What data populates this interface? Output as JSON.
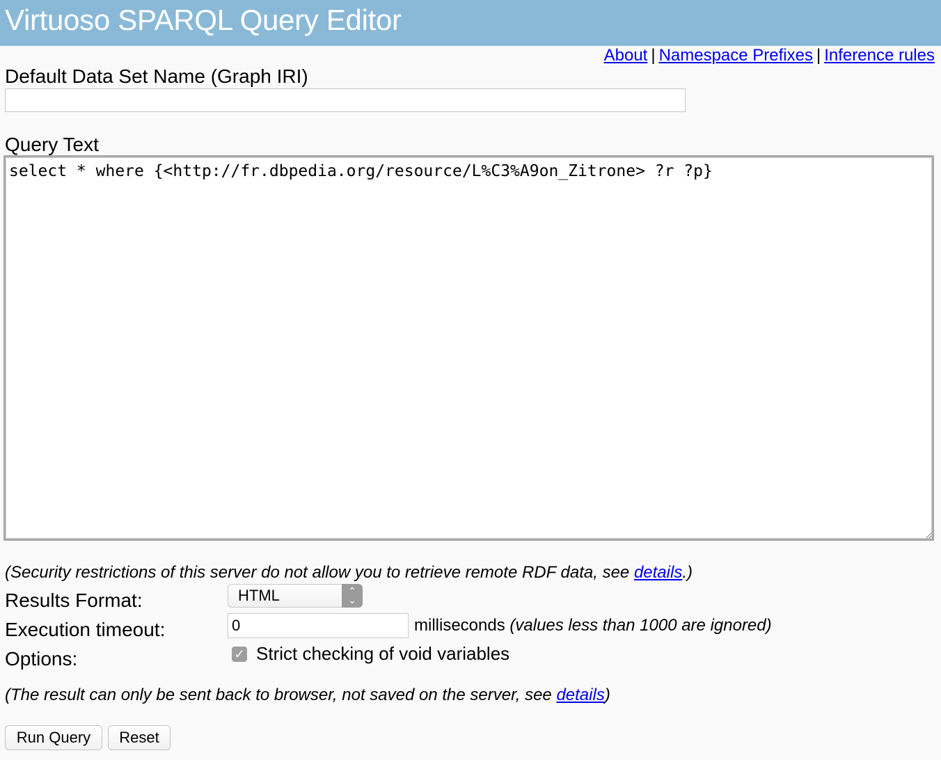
{
  "header": {
    "title": "Virtuoso SPARQL Query Editor"
  },
  "links": {
    "about": "About",
    "namespace_prefixes": "Namespace Prefixes",
    "inference_rules": "Inference rules",
    "separator": "|"
  },
  "graph": {
    "label": "Default Data Set Name (Graph IRI)",
    "value": ""
  },
  "query": {
    "label": "Query Text",
    "value": "select * where {<http://fr.dbpedia.org/resource/L%C3%A9on_Zitrone> ?r ?p}"
  },
  "security_note": {
    "before": "(Security restrictions of this server do not allow you to retrieve remote RDF data, see ",
    "link": "details",
    "after": ".)"
  },
  "results_format": {
    "label": "Results Format:",
    "selected": "HTML"
  },
  "timeout": {
    "label": "Execution timeout:",
    "value": "0",
    "unit": "milliseconds",
    "hint": "(values less than 1000 are ignored)"
  },
  "options": {
    "label": "Options:",
    "strict_checking_label": "Strict checking of void variables",
    "strict_checking_checked": true
  },
  "result_note": {
    "before": "(The result can only be sent back to browser, not saved on the server, see ",
    "link": "details",
    "after": ")"
  },
  "buttons": {
    "run": "Run Query",
    "reset": "Reset"
  }
}
